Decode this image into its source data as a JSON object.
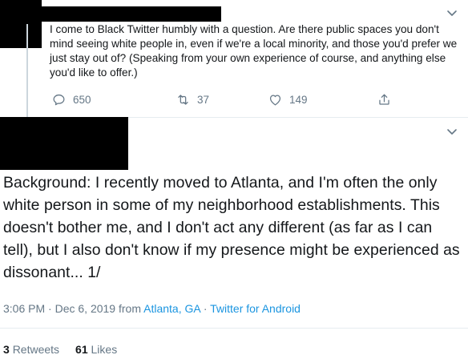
{
  "parent_tweet": {
    "text": "I come to Black Twitter humbly with a question. Are there public spaces you don't mind seeing white people in, even if we're a local minority, and those you'd prefer we just stay out of? (Speaking from your own experience of course, and anything else you'd like to offer.)",
    "reply_count": "650",
    "retweet_count": "37",
    "like_count": "149",
    "menu_icon": "chevron-down-icon"
  },
  "main_tweet": {
    "text": "Background: I recently moved to Atlanta, and I'm often the only white person in some of my neighborhood establishments. This doesn't bother me, and I don't act any different (as far as I can tell), but I also don't know if my presence might be experienced as dissonant... 1/",
    "time": "3:06 PM",
    "sep1": " · ",
    "date": "Dec 6, 2019",
    "from_label": " from ",
    "location": "Atlanta, GA",
    "sep2": " · ",
    "client": "Twitter for Android",
    "retweets_count": "3",
    "retweets_label": "Retweets",
    "likes_count": "61",
    "likes_label": "Likes"
  },
  "colors": {
    "text": "#14171a",
    "muted": "#657786",
    "link": "#1b95e0",
    "divider": "#e6ecf0",
    "redaction": "#000000"
  }
}
